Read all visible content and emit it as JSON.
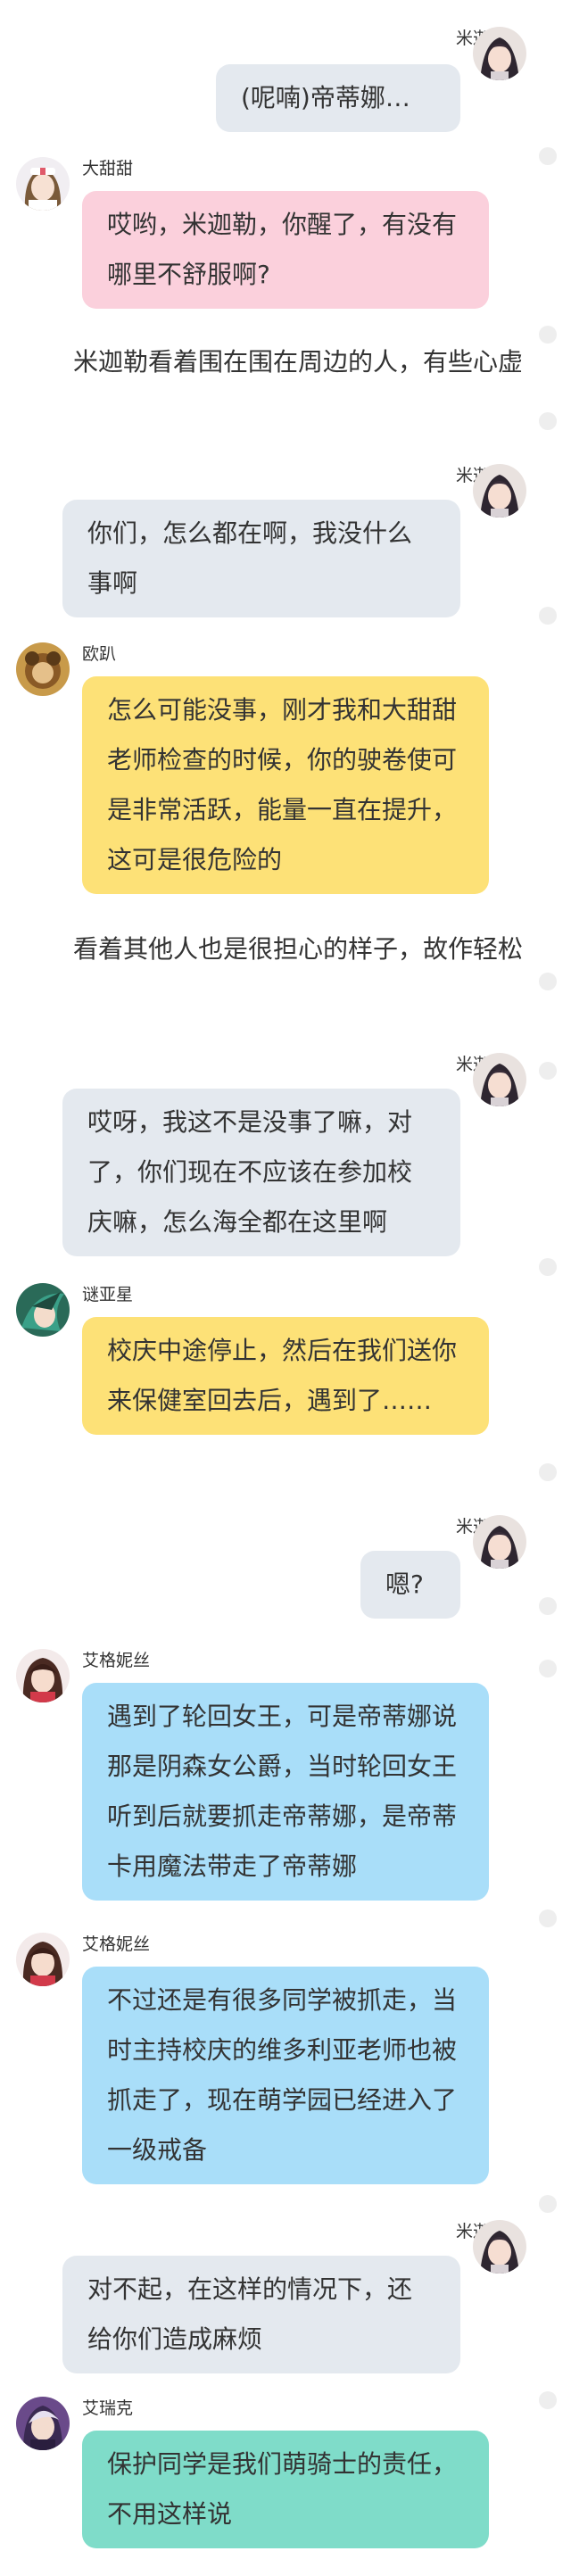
{
  "messages": [
    {
      "type": "right",
      "speaker": "米迦勒",
      "text": "(呢喃)帝蒂娜…",
      "color": "gray",
      "avatar": "avatar-mikael"
    },
    {
      "type": "left",
      "speaker": "大甜甜",
      "text": "哎哟，米迦勒，你醒了，有没有哪里不舒服啊?",
      "color": "pink",
      "avatar": "avatar-datiantian"
    },
    {
      "type": "narration",
      "text": "米迦勒看着围在围在周边的人，有些心虚"
    },
    {
      "type": "right",
      "speaker": "米迦勒",
      "text": "你们，怎么都在啊，我没什么事啊",
      "color": "gray",
      "avatar": "avatar-mikael"
    },
    {
      "type": "left",
      "speaker": "欧趴",
      "text": "怎么可能没事，刚才我和大甜甜老师检查的时候，你的驶卷使可是非常活跃，能量一直在提升，这可是很危险的",
      "color": "yellow",
      "avatar": "avatar-oupa"
    },
    {
      "type": "narration",
      "text": "看着其他人也是很担心的样子，故作轻松"
    },
    {
      "type": "right",
      "speaker": "米迦勒",
      "text": "哎呀，我这不是没事了嘛，对了，你们现在不应该在参加校庆嘛，怎么海全都在这里啊",
      "color": "gray",
      "avatar": "avatar-mikael"
    },
    {
      "type": "left",
      "speaker": "谜亚星",
      "text": "校庆中途停止，然后在我们送你来保健室回去后，遇到了……",
      "color": "yellow",
      "avatar": "avatar-miyaxing"
    },
    {
      "type": "right",
      "speaker": "米迦勒",
      "text": "嗯?",
      "color": "gray",
      "avatar": "avatar-mikael"
    },
    {
      "type": "left",
      "speaker": "艾格妮丝",
      "text": "遇到了轮回女王，可是帝蒂娜说那是阴森女公爵，当时轮回女王听到后就要抓走帝蒂娜，是帝蒂卡用魔法带走了帝蒂娜",
      "color": "blue",
      "avatar": "avatar-aigenisi"
    },
    {
      "type": "left",
      "speaker": "艾格妮丝",
      "text": "不过还是有很多同学被抓走，当时主持校庆的维多利亚老师也被抓走了，现在萌学园已经进入了一级戒备",
      "color": "blue",
      "avatar": "avatar-aigenisi"
    },
    {
      "type": "right",
      "speaker": "米迦勒",
      "text": "对不起，在这样的情况下，还给你们造成麻烦",
      "color": "gray",
      "avatar": "avatar-mikael"
    },
    {
      "type": "left",
      "speaker": "艾瑞克",
      "text": "保护同学是我们萌骑士的责任，不用这样说",
      "color": "teal",
      "avatar": "avatar-airuike"
    }
  ]
}
